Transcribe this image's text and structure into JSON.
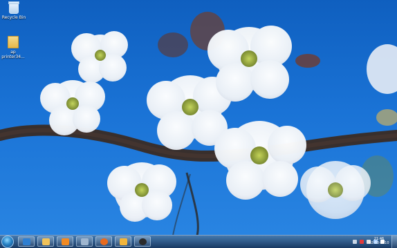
{
  "desktop": {
    "icons": [
      {
        "label": "Recycle Bin",
        "glyph": "recycle-bin-icon"
      },
      {
        "label": "ap\nprinter34...",
        "glyph": "folder-icon"
      }
    ]
  },
  "taskbar": {
    "start": "start-orb",
    "pinned": [
      {
        "name": "internet-explorer-icon",
        "color": "#2f7fd1"
      },
      {
        "name": "explorer-icon",
        "color": "#f0c25a"
      },
      {
        "name": "media-player-icon",
        "color": "#f08a24"
      },
      {
        "name": "network-icon",
        "color": "#9fb6cf"
      },
      {
        "name": "firefox-icon",
        "color": "#e76a1e"
      },
      {
        "name": "outlook-icon",
        "color": "#f2b53b"
      },
      {
        "name": "app-owl-icon",
        "color": "#2b2b2b"
      }
    ],
    "tray": {
      "icons": [
        "tray-up-arrow-icon",
        "tray-red-icon",
        "tray-flag-icon",
        "tray-network-icon",
        "tray-volume-icon"
      ]
    },
    "clock": {
      "time": "21:46",
      "date": "02-03-2010"
    }
  },
  "colors": {
    "sky": "#1a73d6",
    "blossom": "#f5f8ff",
    "branch": "#3a2b24"
  }
}
